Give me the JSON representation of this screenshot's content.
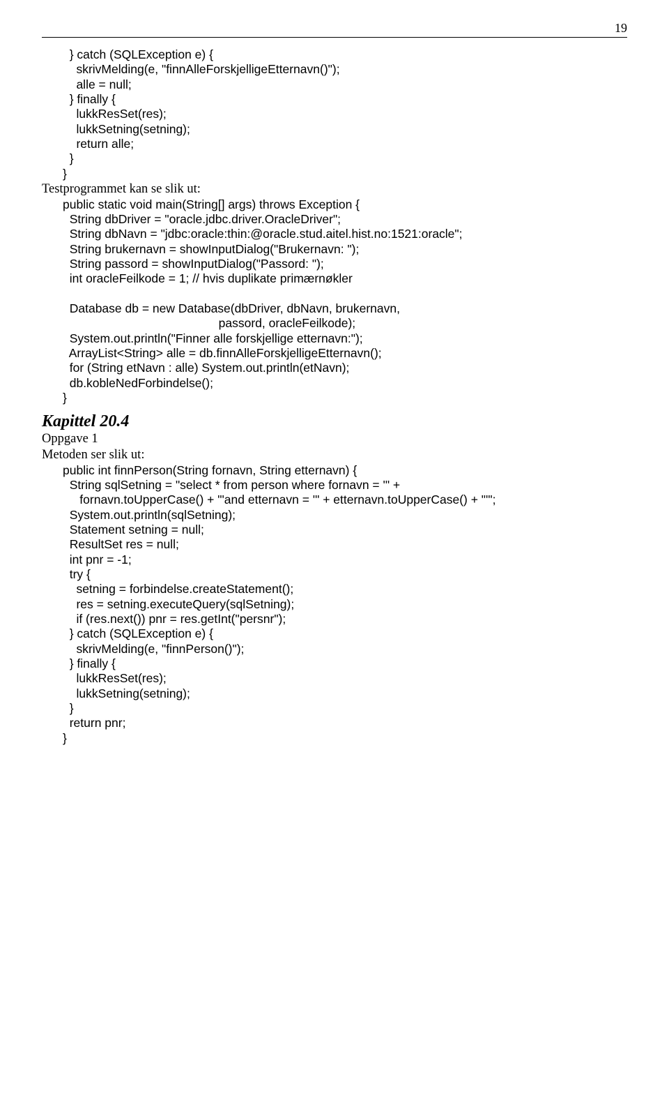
{
  "pageNumber": "19",
  "code1": "  } catch (SQLException e) {\n    skrivMelding(e, \"finnAlleForskjelligeEtternavn()\");\n    alle = null;\n  } finally {\n    lukkResSet(res);\n    lukkSetning(setning);\n    return alle;\n  }\n}",
  "prose1": "Testprogrammet kan se slik ut:",
  "code2": "public static void main(String[] args) throws Exception {\n  String dbDriver = \"oracle.jdbc.driver.OracleDriver\";\n  String dbNavn = \"jdbc:oracle:thin:@oracle.stud.aitel.hist.no:1521:oracle\";\n  String brukernavn = showInputDialog(\"Brukernavn: \");\n  String passord = showInputDialog(\"Passord: \");\n  int oracleFeilkode = 1; // hvis duplikate primærnøkler\n\n  Database db = new Database(dbDriver, dbNavn, brukernavn,\n                                              passord, oracleFeilkode);\n  System.out.println(\"Finner alle forskjellige etternavn:\");\n  ArrayList<String> alle = db.finnAlleForskjelligeEtternavn();\n  for (String etNavn : alle) System.out.println(etNavn);\n  db.kobleNedForbindelse();\n}",
  "kapittel": "Kapittel 20.4",
  "oppgave": "Oppgave 1",
  "prose2": "Metoden ser slik ut:",
  "code3": "public int finnPerson(String fornavn, String etternavn) {\n  String sqlSetning = \"select * from person where fornavn = '\" +\n     fornavn.toUpperCase() + \"'and etternavn = '\" + etternavn.toUpperCase() + \"'\";\n  System.out.println(sqlSetning);\n  Statement setning = null;\n  ResultSet res = null;\n  int pnr = -1;\n  try {\n    setning = forbindelse.createStatement();\n    res = setning.executeQuery(sqlSetning);\n    if (res.next()) pnr = res.getInt(\"persnr\");\n  } catch (SQLException e) {\n    skrivMelding(e, \"finnPerson()\");\n  } finally {\n    lukkResSet(res);\n    lukkSetning(setning);\n  }\n  return pnr;\n}"
}
